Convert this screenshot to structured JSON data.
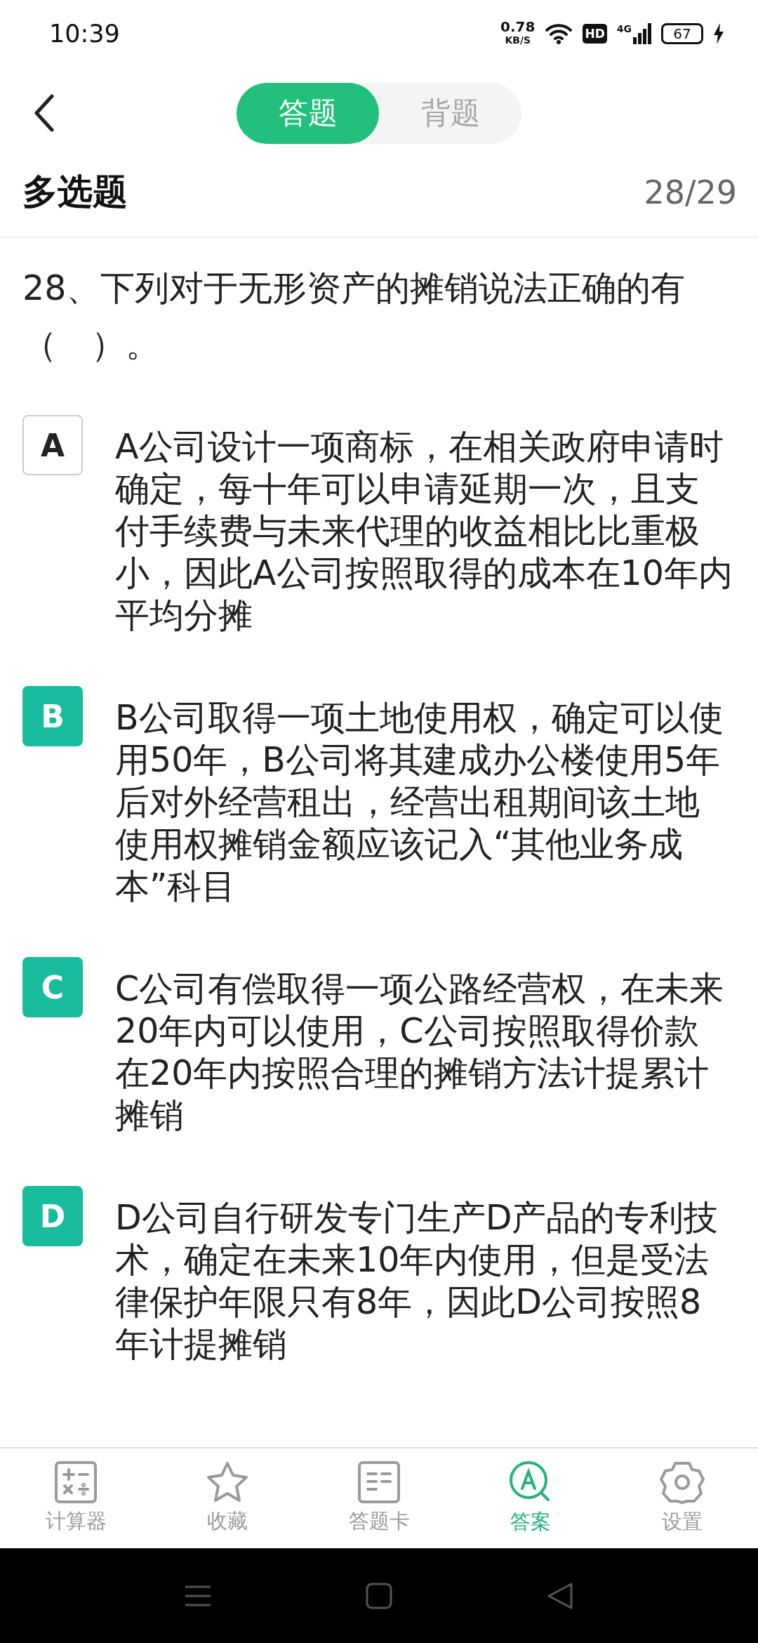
{
  "status_bar": {
    "time": "10:39",
    "speed_value": "0.78",
    "speed_unit": "KB/S",
    "hd": "HD",
    "network": "4G",
    "battery": "67"
  },
  "mode_tabs": [
    {
      "label": "答题",
      "selected": true
    },
    {
      "label": "背题",
      "selected": false
    }
  ],
  "question_type": "多选题",
  "progress": "28/29",
  "question": "28、下列对于无形资产的摊销说法正确的有（　）。",
  "options": [
    {
      "letter": "A",
      "text": "A公司设计一项商标，在相关政府申请时确定，每十年可以申请延期一次，且支付手续费与未来代理的收益相比比重极小，因此A公司按照取得的成本在10年内平均分摊",
      "selected": false
    },
    {
      "letter": "B",
      "text": "B公司取得一项土地使用权，确定可以使用50年，B公司将其建成办公楼使用5年后对外经营租出，经营出租期间该土地使用权摊销金额应该记入“其他业务成本”科目",
      "selected": true
    },
    {
      "letter": "C",
      "text": "C公司有偿取得一项公路经营权，在未来20年内可以使用，C公司按照取得价款在20年内按照合理的摊销方法计提累计摊销",
      "selected": true
    },
    {
      "letter": "D",
      "text": "D公司自行研发专门生产D产品的专利技术，确定在未来10年内使用，但是受法律保护年限只有8年，因此D公司按照8年计提摊销",
      "selected": true
    }
  ],
  "bottom_nav": [
    {
      "label": "计算器",
      "kind": "calculator",
      "selected": false
    },
    {
      "label": "收藏",
      "kind": "star",
      "selected": false
    },
    {
      "label": "答题卡",
      "kind": "card",
      "selected": false
    },
    {
      "label": "答案",
      "kind": "answer",
      "selected": true
    },
    {
      "label": "设置",
      "kind": "settings",
      "selected": false
    }
  ]
}
